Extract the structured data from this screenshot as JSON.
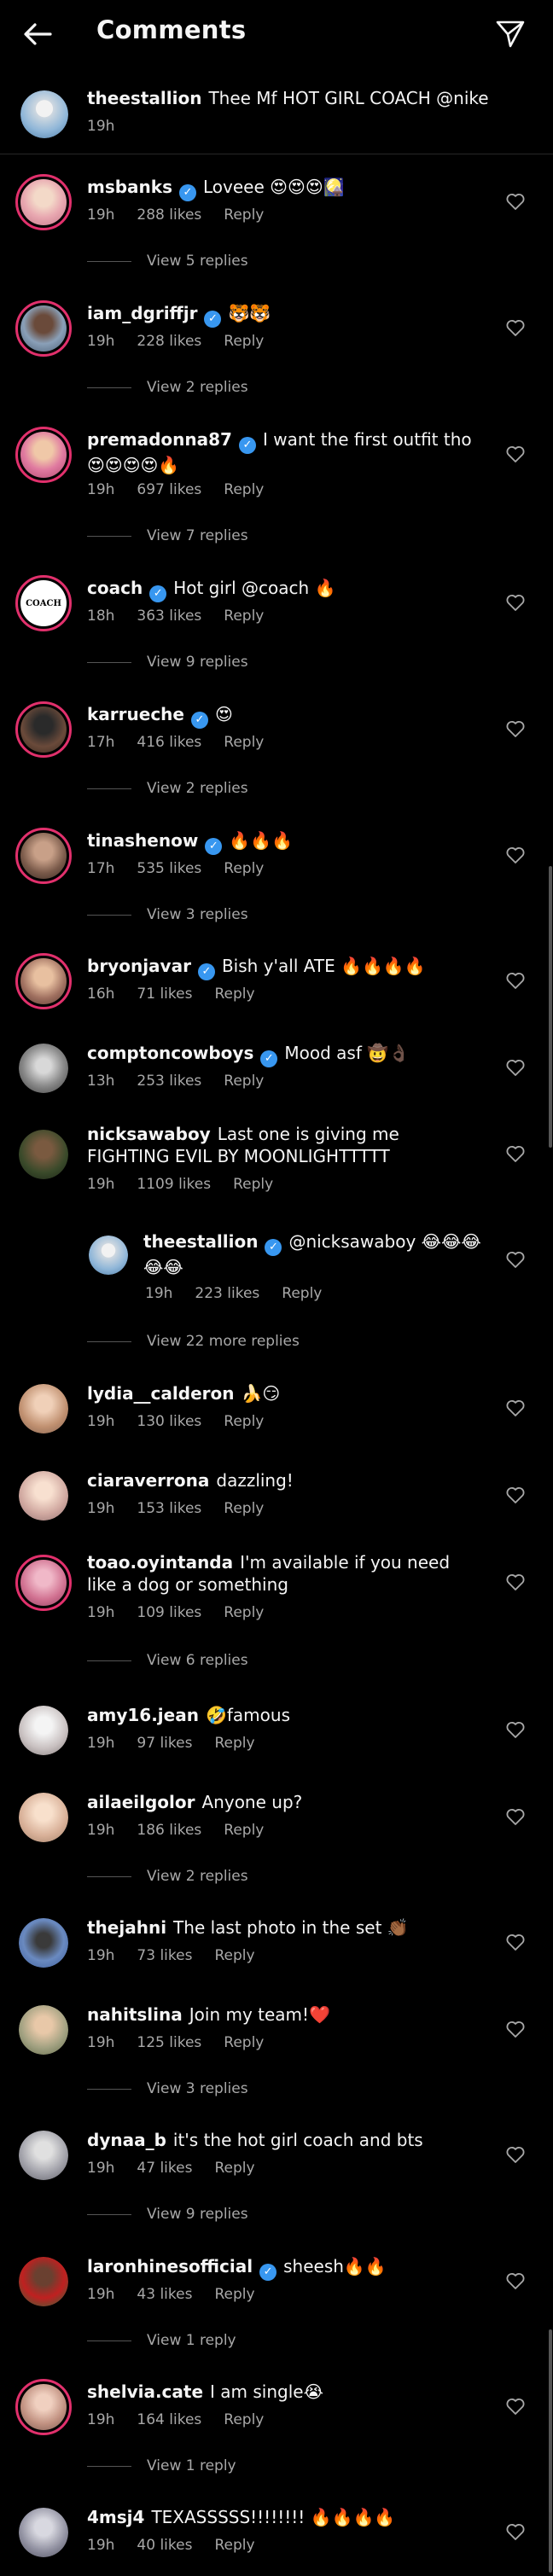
{
  "header": {
    "title": "Comments",
    "back_icon": "arrow-left-icon",
    "send_icon": "paper-plane-icon"
  },
  "caption": {
    "username": "theestallion",
    "text": "Thee Mf HOT GIRL COACH @nike",
    "time": "19h"
  },
  "comments": [
    {
      "username": "msbanks",
      "verified": true,
      "text": "Loveee 😍😍😍🎑",
      "time": "19h",
      "likes": "288 likes",
      "reply": "Reply",
      "view_replies": "View 5 replies"
    },
    {
      "username": "iam_dgriffjr",
      "verified": true,
      "text": "🐯🐯",
      "time": "19h",
      "likes": "228 likes",
      "reply": "Reply",
      "view_replies": "View 2 replies"
    },
    {
      "username": "premadonna87",
      "verified": true,
      "text": "I want the first outfit tho 😍😍😍😍🔥",
      "time": "19h",
      "likes": "697 likes",
      "reply": "Reply",
      "view_replies": "View 7 replies"
    },
    {
      "username": "coach",
      "verified": true,
      "text": "Hot girl @coach 🔥",
      "time": "18h",
      "likes": "363 likes",
      "reply": "Reply",
      "view_replies": "View 9 replies"
    },
    {
      "username": "karrueche",
      "verified": true,
      "text": "😍",
      "time": "17h",
      "likes": "416 likes",
      "reply": "Reply",
      "view_replies": "View 2 replies"
    },
    {
      "username": "tinashenow",
      "verified": true,
      "text": "🔥🔥🔥",
      "time": "17h",
      "likes": "535 likes",
      "reply": "Reply",
      "view_replies": "View 3 replies"
    },
    {
      "username": "bryonjavar",
      "verified": true,
      "text": "Bish y'all ATE 🔥🔥🔥🔥",
      "time": "16h",
      "likes": "71 likes",
      "reply": "Reply",
      "view_replies": ""
    },
    {
      "username": "comptoncowboys",
      "verified": true,
      "text": "Mood asf 🤠👌🏿",
      "time": "13h",
      "likes": "253 likes",
      "reply": "Reply",
      "view_replies": ""
    },
    {
      "username": "nicksawaboy",
      "verified": false,
      "text": "Last one is giving me FIGHTING EVIL BY MOONLIGHTTTTT",
      "time": "19h",
      "likes": "1109 likes",
      "reply": "Reply",
      "view_replies": ""
    },
    {
      "username": "theestallion",
      "verified": true,
      "text": "@nicksawaboy 😂😂😂😂😂",
      "time": "19h",
      "likes": "223 likes",
      "reply": "Reply",
      "view_replies": "View 22 more replies"
    },
    {
      "username": "lydia__calderon",
      "verified": false,
      "text": "🍌😏",
      "time": "19h",
      "likes": "130 likes",
      "reply": "Reply",
      "view_replies": ""
    },
    {
      "username": "ciaraverrona",
      "verified": false,
      "text": "dazzling!",
      "time": "19h",
      "likes": "153 likes",
      "reply": "Reply",
      "view_replies": ""
    },
    {
      "username": "toao.oyintanda",
      "verified": false,
      "text": "I'm available if you need like a dog or something",
      "time": "19h",
      "likes": "109 likes",
      "reply": "Reply",
      "view_replies": "View 6 replies"
    },
    {
      "username": "amy16.jean",
      "verified": false,
      "text": "🤣famous",
      "time": "19h",
      "likes": "97 likes",
      "reply": "Reply",
      "view_replies": ""
    },
    {
      "username": "ailaeilgolor",
      "verified": false,
      "text": "Anyone up?",
      "time": "19h",
      "likes": "186 likes",
      "reply": "Reply",
      "view_replies": "View 2 replies"
    },
    {
      "username": "thejahni",
      "verified": false,
      "text": "The last photo in the set 👏🏾",
      "time": "19h",
      "likes": "73 likes",
      "reply": "Reply",
      "view_replies": ""
    },
    {
      "username": "nahitslina",
      "verified": false,
      "text": "Join my team!❤️",
      "time": "19h",
      "likes": "125 likes",
      "reply": "Reply",
      "view_replies": "View 3 replies"
    },
    {
      "username": "dynaa_b",
      "verified": false,
      "text": "it's the hot girl coach and bts",
      "time": "19h",
      "likes": "47 likes",
      "reply": "Reply",
      "view_replies": "View 9 replies"
    },
    {
      "username": "laronhinesofficial",
      "verified": true,
      "text": "sheesh🔥🔥",
      "time": "19h",
      "likes": "43 likes",
      "reply": "Reply",
      "view_replies": "View 1 reply"
    },
    {
      "username": "shelvia.cate",
      "verified": false,
      "text": "I am single😭",
      "time": "19h",
      "likes": "164 likes",
      "reply": "Reply",
      "view_replies": "View 1 reply"
    },
    {
      "username": "4msj4",
      "verified": false,
      "text": "TEXASSSSS!!!!!!!! 🔥🔥🔥🔥",
      "time": "19h",
      "likes": "40 likes",
      "reply": "Reply",
      "view_replies": ""
    }
  ],
  "colors": {
    "background": "#000000",
    "text": "#f5f5f5",
    "muted": "#a8a8a8",
    "verified": "#3897f0",
    "story_ring": "#e1306c"
  }
}
